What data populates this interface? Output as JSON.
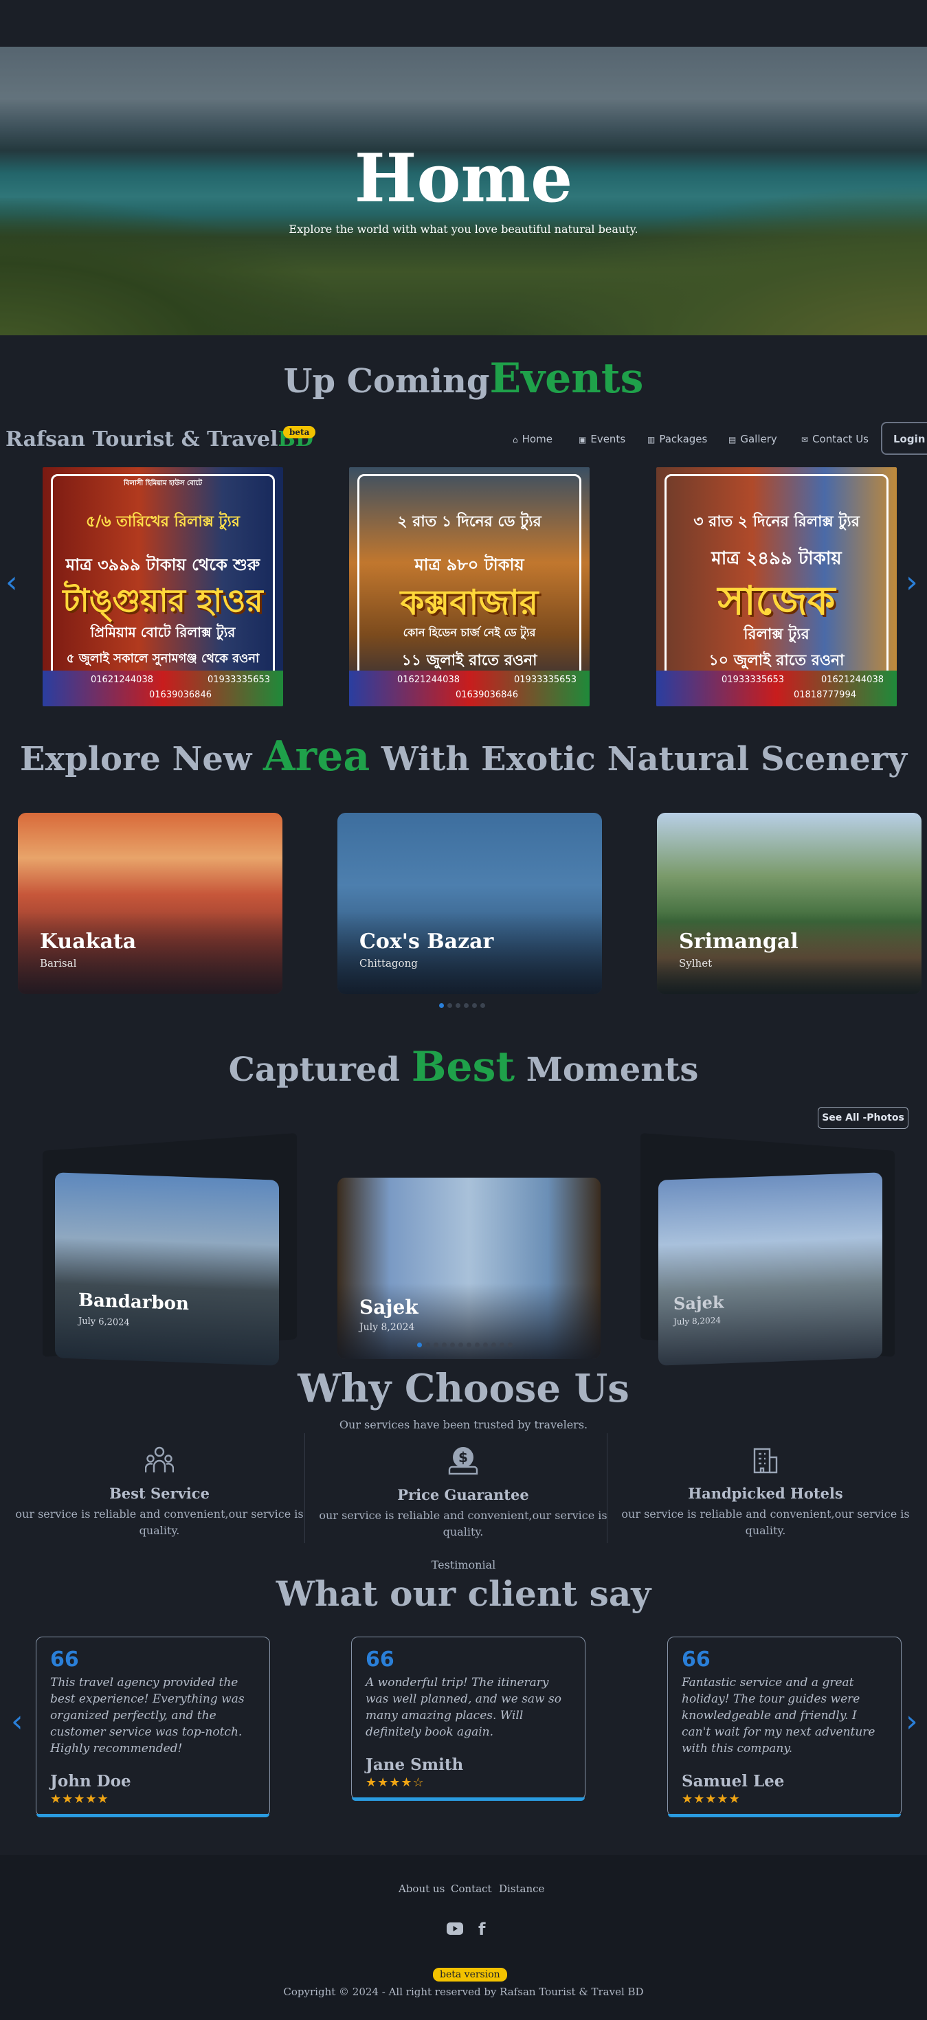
{
  "hero": {
    "title": "Home",
    "subtitle": "Explore the world with what you love beautiful natural beauty."
  },
  "events": {
    "title_a": "Up Coming",
    "title_b": "Events"
  },
  "nav": {
    "brand_a": "Rafsan Tourist & Travel",
    "brand_b": "BD",
    "badge": "beta",
    "items": [
      {
        "label": "Home",
        "icon": "home-icon"
      },
      {
        "label": "Events",
        "icon": "calendar-icon"
      },
      {
        "label": "Packages",
        "icon": "building-icon"
      },
      {
        "label": "Gallery",
        "icon": "image-icon"
      },
      {
        "label": "Contact Us",
        "icon": "mail-icon"
      }
    ],
    "login": "Login"
  },
  "posters": [
    {
      "top": "বিলাসী হিমিয়াম হাউস বোটে",
      "l1": "৫/৬ তারিখের রিলাক্স ট্যুর",
      "l2": "মাত্র ৩৯৯৯ টাকায় থেকে শুরু",
      "big": "টাঙ্গুয়ার হাওর",
      "l3": "প্রিমিয়াম বোটে রিলাক্স ট্যুর",
      "l4": "৫ জুলাই সকালে সুনামগঞ্জ থেকে রওনা",
      "p1": "01621244038",
      "p2": "01933335653",
      "p3": "01639036846"
    },
    {
      "top": "",
      "l1": "২ রাত ১ দিনের ডে ট্যুর",
      "l2": "মাত্র ৯৮০ টাকায়",
      "big": "কক্সবাজার",
      "l3": "কোন হিডেন চার্জ নেই ডে ট্যুর",
      "l4": "১১ জুলাই রাতে রওনা",
      "p1": "01621244038",
      "p2": "01933335653",
      "p3": "01639036846"
    },
    {
      "top": "",
      "l1": "৩ রাত ২ দিনের রিলাক্স ট্যুর",
      "l2": "মাত্র ২৪৯৯ টাকায়",
      "big": "সাজেক",
      "l3": "রিলাক্স ট্যুর",
      "l4": "১০ জুলাই রাতে রওনা",
      "p1": "01933335653",
      "p2": "01621244038",
      "p3": "01818777994"
    }
  ],
  "explore": {
    "title_a": "Explore New ",
    "title_b": "Area",
    "title_c": " With Exotic Natural Scenery"
  },
  "areas": [
    {
      "name": "Kuakata",
      "region": "Barisal"
    },
    {
      "name": "Cox's Bazar",
      "region": "Chittagong"
    },
    {
      "name": "Srimangal",
      "region": "Sylhet"
    }
  ],
  "moments": {
    "title_a": "Captured ",
    "title_b": "Best",
    "title_c": " Moments",
    "see_all": "See All -Photos"
  },
  "photos": [
    {
      "name": "Bandarbon",
      "date": "July 6,2024"
    },
    {
      "name": "Sajek",
      "date": "July 8,2024"
    },
    {
      "name": "Sajek",
      "date": "July 8,2024"
    }
  ],
  "why": {
    "title": "Why Choose Us",
    "subtitle": "Our services have been trusted by travelers.",
    "features": [
      {
        "title": "Best Service",
        "desc": "our service is reliable and convenient,our service is quality.",
        "icon": "users-icon"
      },
      {
        "title": "Price Guarantee",
        "desc": "our service is reliable and convenient,our service is quality.",
        "icon": "dollar-icon"
      },
      {
        "title": "Handpicked Hotels",
        "desc": "our service is reliable and convenient,our service is quality.",
        "icon": "hotel-icon"
      }
    ]
  },
  "testimonial": {
    "eyebrow": "Testimonial",
    "title": "What our client say",
    "quote_mark": "66",
    "items": [
      {
        "text": "This travel agency provided the best experience! Everything was organized perfectly, and the customer service was top-notch. Highly recommended!",
        "name": "John Doe",
        "stars": "★★★★★"
      },
      {
        "text": "A wonderful trip! The itinerary was well planned, and we saw so many amazing places. Will definitely book again.",
        "name": "Jane Smith",
        "stars": "★★★★☆"
      },
      {
        "text": "Fantastic service and a great holiday! The tour guides were knowledgeable and friendly. I can't wait for my next adventure with this company.",
        "name": "Samuel Lee",
        "stars": "★★★★★"
      }
    ]
  },
  "footer": {
    "links": [
      "About us",
      "Contact",
      "Distance"
    ],
    "badge": "beta version",
    "copyright": "Copyright © 2024 - All right reserved by Rafsan Tourist & Travel BD"
  },
  "colors": {
    "accent_green": "#1fa14a",
    "accent_blue": "#2a7fd8",
    "badge_yellow": "#f2c200",
    "background": "#1b1f27"
  }
}
